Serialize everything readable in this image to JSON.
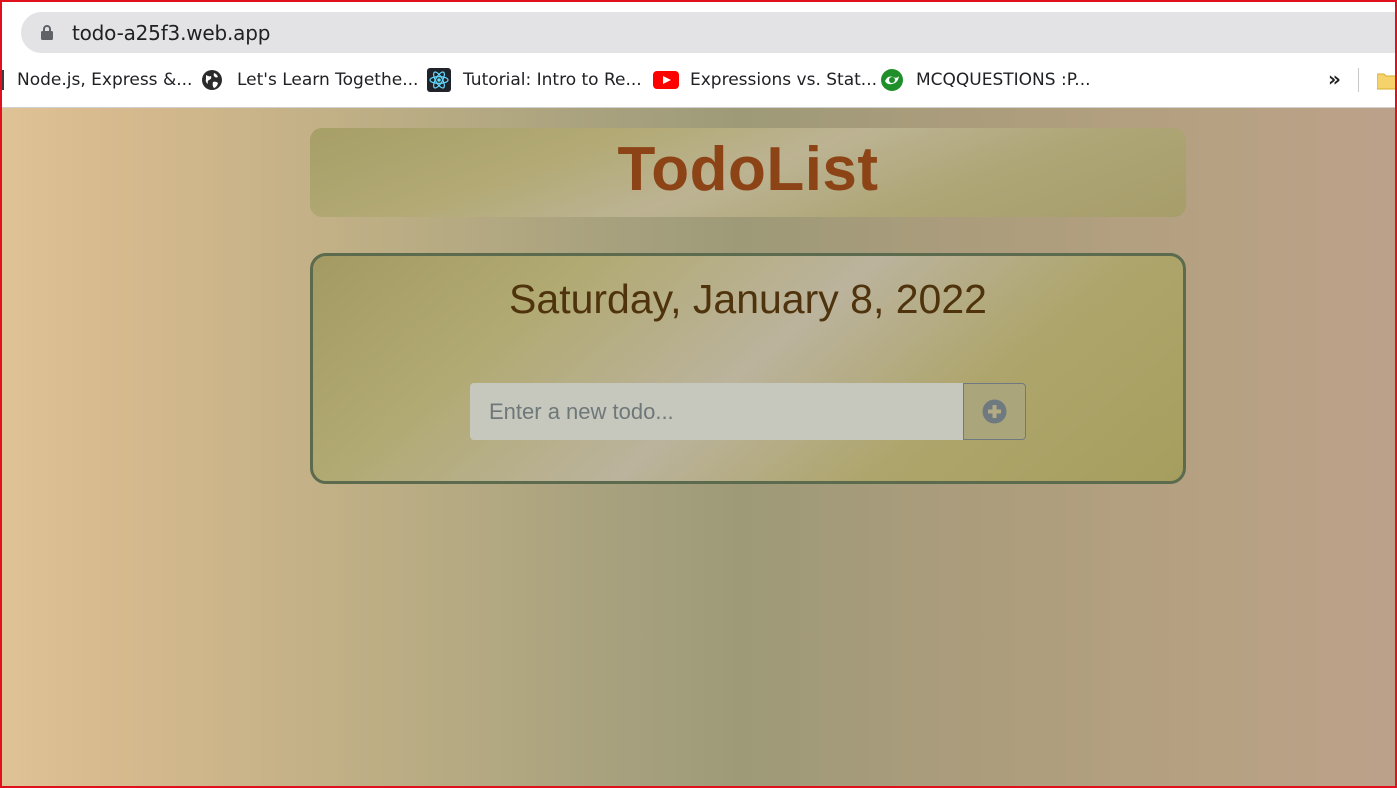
{
  "browser": {
    "url": "todo-a25f3.web.app",
    "bookmarks": [
      {
        "label": "Node.js, Express &...",
        "icon": "bookmark-favicon"
      },
      {
        "label": "Let's Learn Togethe...",
        "icon": "globe-icon"
      },
      {
        "label": "Tutorial: Intro to Re...",
        "icon": "react-icon"
      },
      {
        "label": "Expressions vs. Stat...",
        "icon": "youtube-icon"
      },
      {
        "label": "MCQQUESTIONS :P...",
        "icon": "mcq-icon"
      }
    ],
    "more_label": "»"
  },
  "app": {
    "title": "TodoList",
    "date": "Saturday, January 8, 2022",
    "input": {
      "placeholder": "Enter a new todo...",
      "value": ""
    },
    "add_icon": "plus-circle-icon"
  },
  "colors": {
    "heading": "#8c4416",
    "date": "#4e330d",
    "card_border": "#5c6a4e",
    "window_border": "#e0101c"
  }
}
